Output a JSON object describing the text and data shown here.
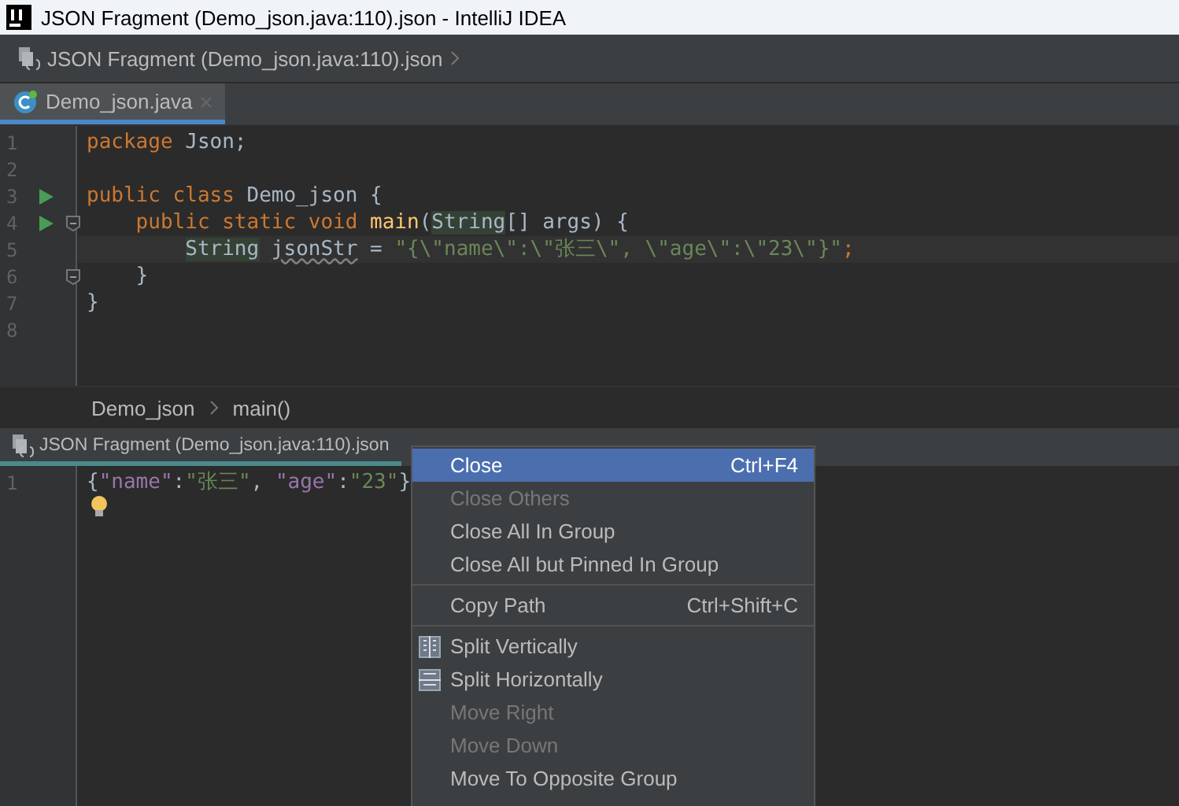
{
  "window": {
    "title": "JSON Fragment (Demo_json.java:110).json - IntelliJ IDEA"
  },
  "navigation_bar": {
    "path": "JSON Fragment (Demo_json.java:110).json"
  },
  "editor_tabs": [
    {
      "label": "Demo_json.java",
      "selected": true
    }
  ],
  "editor": {
    "lines": [
      {
        "number": "1",
        "run_marker": false,
        "fold_marker": false,
        "current": false,
        "tokens": [
          {
            "text": "package ",
            "kind": "keyword"
          },
          {
            "text": "Json;",
            "kind": "plain"
          }
        ]
      },
      {
        "number": "2",
        "run_marker": false,
        "fold_marker": false,
        "current": false
      },
      {
        "number": "3",
        "run_marker": true,
        "fold_marker": false,
        "current": false,
        "tokens": [
          {
            "text": "public class ",
            "kind": "keyword"
          },
          {
            "text": "Demo_json {",
            "kind": "plain"
          }
        ]
      },
      {
        "number": "4",
        "run_marker": true,
        "fold_marker": true,
        "current": false,
        "tokens": [
          {
            "text": "    public static void ",
            "kind": "keyword"
          },
          {
            "text": "main",
            "kind": "method"
          },
          {
            "text": "(",
            "kind": "plain"
          },
          {
            "text": "String",
            "kind": "highlight"
          },
          {
            "text": "[] args) {",
            "kind": "plain"
          }
        ]
      },
      {
        "number": "5",
        "run_marker": false,
        "fold_marker": false,
        "current": true,
        "tokens": [
          {
            "text": "        String",
            "kind": "highlight"
          },
          {
            "text": " jsonStr",
            "kind": "warning"
          },
          {
            "text": " = ",
            "kind": "plain"
          },
          {
            "text": "\"{\\\"name\\\":\\\"张三\\\", \\\"age\\\":\\\"23\\\"}\"",
            "kind": "string"
          },
          {
            "text": ";",
            "kind": "keyword"
          }
        ]
      },
      {
        "number": "6",
        "run_marker": false,
        "fold_marker": true,
        "current": false,
        "tokens": [
          {
            "text": "    }",
            "kind": "plain"
          }
        ]
      },
      {
        "number": "7",
        "run_marker": false,
        "fold_marker": false,
        "current": false,
        "tokens": [
          {
            "text": "}",
            "kind": "plain"
          }
        ]
      },
      {
        "number": "8",
        "run_marker": false,
        "fold_marker": false,
        "current": false
      }
    ]
  },
  "breadcrumbs": [
    "Demo_json",
    "main()"
  ],
  "fragment_tabs": [
    {
      "label": "JSON Fragment (Demo_json.java:110).json",
      "selected": true
    }
  ],
  "fragment_editor": {
    "lines": [
      {
        "number": "1",
        "tokens": [
          {
            "text": "{",
            "kind": "plain"
          },
          {
            "text": "\"name\"",
            "kind": "key"
          },
          {
            "text": ":",
            "kind": "plain"
          },
          {
            "text": "\"张三\"",
            "kind": "string"
          },
          {
            "text": ", ",
            "kind": "plain"
          },
          {
            "text": "\"age\"",
            "kind": "key"
          },
          {
            "text": ":",
            "kind": "plain"
          },
          {
            "text": "\"23\"",
            "kind": "string"
          },
          {
            "text": "}",
            "kind": "plain"
          }
        ]
      }
    ],
    "intention_bulb": true
  },
  "context_menu": [
    {
      "kind": "item",
      "label": "Close",
      "shortcut": "Ctrl+F4",
      "selected": true,
      "disabled": false
    },
    {
      "kind": "item",
      "label": "Close Others",
      "selected": false,
      "disabled": true
    },
    {
      "kind": "item",
      "label": "Close All In Group",
      "selected": false,
      "disabled": false
    },
    {
      "kind": "item",
      "label": "Close All but Pinned In Group",
      "selected": false,
      "disabled": false
    },
    {
      "kind": "separator"
    },
    {
      "kind": "item",
      "label": "Copy Path",
      "shortcut": "Ctrl+Shift+C",
      "selected": false,
      "disabled": false
    },
    {
      "kind": "separator"
    },
    {
      "kind": "vsplit",
      "label": "Split Vertically",
      "selected": false,
      "disabled": false
    },
    {
      "kind": "hsplit",
      "label": "Split Horizontally",
      "selected": false,
      "disabled": false
    },
    {
      "kind": "item",
      "label": "Move Right",
      "selected": false,
      "disabled": true
    },
    {
      "kind": "item",
      "label": "Move Down",
      "selected": false,
      "disabled": true
    },
    {
      "kind": "item",
      "label": "Move To Opposite Group",
      "selected": false,
      "disabled": false
    }
  ]
}
